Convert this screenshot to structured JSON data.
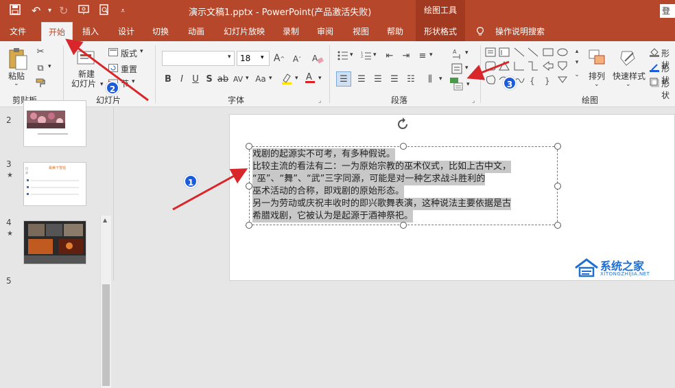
{
  "titlebar": {
    "title": "演示文稿1.pptx  -  PowerPoint(产品激活失败)",
    "context_tab": "绘图工具",
    "login": "登"
  },
  "tabs": [
    {
      "label": "文件"
    },
    {
      "label": "开始"
    },
    {
      "label": "插入"
    },
    {
      "label": "设计"
    },
    {
      "label": "切换"
    },
    {
      "label": "动画"
    },
    {
      "label": "幻灯片放映"
    },
    {
      "label": "录制"
    },
    {
      "label": "审阅"
    },
    {
      "label": "视图"
    },
    {
      "label": "帮助"
    },
    {
      "label": "形状格式"
    },
    {
      "label": "操作说明搜索"
    }
  ],
  "ribbon": {
    "paste": "粘贴",
    "clipboard_group": "剪贴板",
    "new_slide": "新建\n幻灯片",
    "new_slide_l1": "新建",
    "new_slide_l2": "幻灯片",
    "layout": "版式",
    "reset": "重置",
    "section": "节",
    "slides_group": "幻灯片",
    "font_size": "18",
    "font_group": "字体",
    "paragraph_group": "段落",
    "arrange": "排列",
    "quick_styles": "快速样式",
    "shape_fill": "形状",
    "shape_outline": "形状",
    "shape_effects": "形状",
    "drawing_group": "绘图"
  },
  "slides_panel": {
    "items": [
      {
        "number": "2",
        "star": ""
      },
      {
        "number": "3",
        "star": "★"
      },
      {
        "number": "4",
        "star": "★"
      }
    ],
    "slide3_title": "最美下雪拍"
  },
  "textbox": {
    "lines": [
      "戏剧的起源实不可考，有多种假说。",
      "比较主流的看法有二：一为原始宗教的巫术仪式，比如上古中文，",
      "“巫”、“舞”、“武”三字同源，可能是对一种乞求战斗胜利的",
      "巫术活动的合称，即戏剧的原始形态。",
      "另一为劳动或庆祝丰收时的即兴歌舞表演，这种说法主要依据是古",
      "希腊戏剧，它被认为是起源于酒神祭祀。"
    ]
  },
  "annotations": {
    "badge1": "1",
    "badge2": "2",
    "badge3": "3"
  },
  "watermark": {
    "name": "系统之家",
    "url": "XITONGZHIJIA.NET"
  },
  "colors": {
    "accent": "#b7472a",
    "badge": "#1e5bd8",
    "arrow": "#d9262b"
  }
}
